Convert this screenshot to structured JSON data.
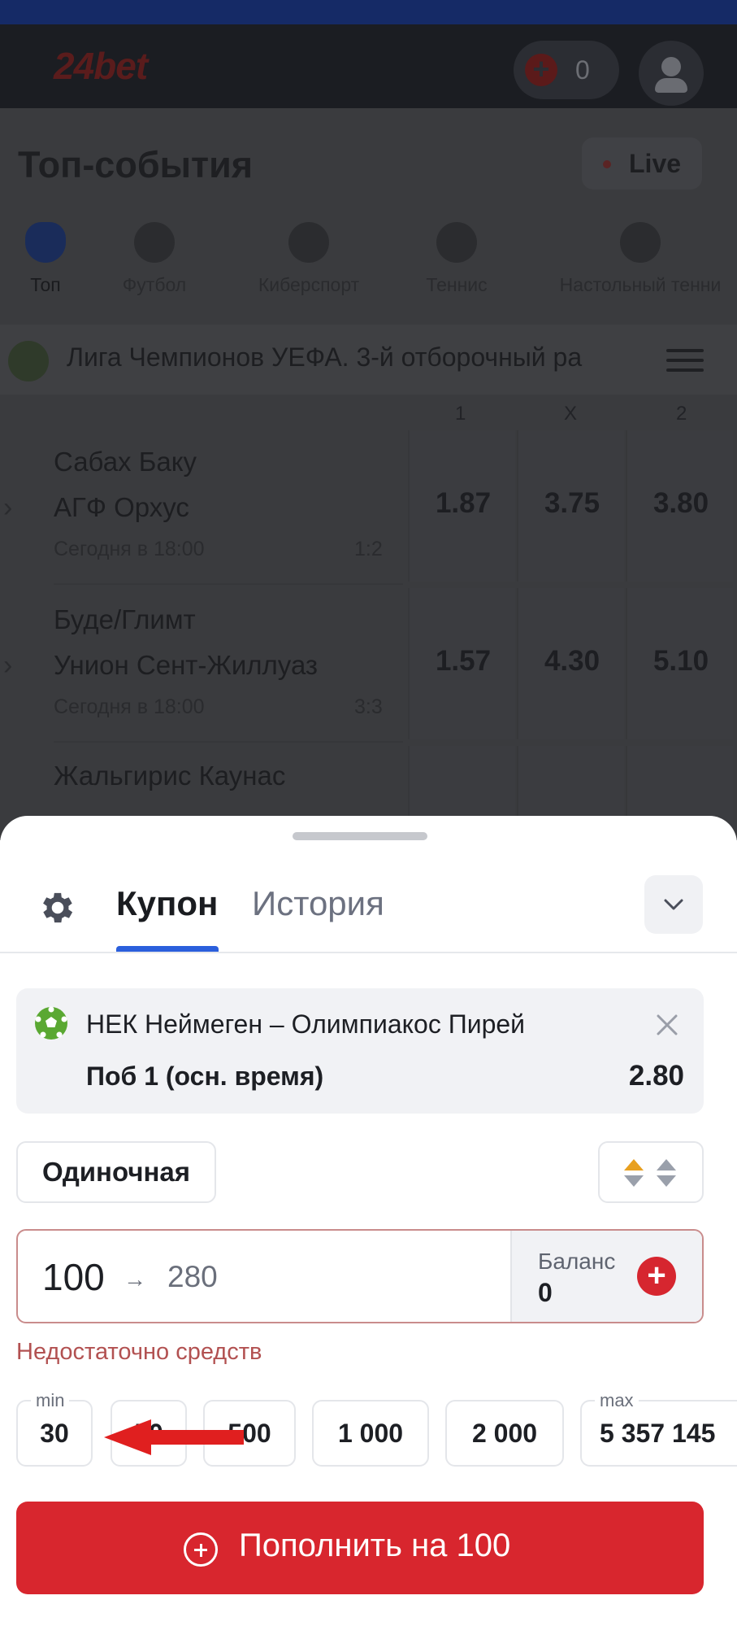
{
  "app": {
    "logo": "24bet",
    "wallet_count": "0"
  },
  "main": {
    "title": "Топ-события",
    "live_label": "Live",
    "sports": [
      {
        "label": "Топ"
      },
      {
        "label": "Футбол"
      },
      {
        "label": "Киберспорт"
      },
      {
        "label": "Теннис"
      },
      {
        "label": "Настольный тенни"
      }
    ],
    "league": "Лига Чемпионов УЕФА. 3-й отборочный ра",
    "odds_columns": [
      "1",
      "X",
      "2"
    ],
    "events": [
      {
        "home": "Сабах Баку",
        "away": "АГФ Орхус",
        "time": "Сегодня в 18:00",
        "score": "1:2",
        "odds": [
          "1.87",
          "3.75",
          "3.80"
        ]
      },
      {
        "home": "Буде/Глимт",
        "away": "Унион Сент-Жиллуаз",
        "time": "Сегодня в 18:00",
        "score": "3:3",
        "odds": [
          "1.57",
          "4.30",
          "5.10"
        ]
      },
      {
        "home": "Жальгирис Каунас",
        "away": "",
        "time": "",
        "score": "",
        "odds": [
          "",
          "",
          ""
        ]
      }
    ]
  },
  "coupon": {
    "tab_coupon": "Купон",
    "tab_history": "История",
    "bet": {
      "match": "НЕК Неймеген – Олимпиакос Пирей",
      "market": "Поб 1 (осн. время)",
      "odd": "2.80"
    },
    "bet_type": "Одиночная",
    "stake": "100",
    "arrow": "→",
    "potential_win": "280",
    "balance_label": "Баланс",
    "balance_value": "0",
    "error": "Недостаточно средств",
    "quick_amounts": {
      "min_tag": "min",
      "max_tag": "max",
      "values": [
        "30",
        "50",
        "500",
        "1 000",
        "2 000",
        "5 357 145"
      ]
    },
    "topup_label": "Пополнить на 100"
  },
  "colors": {
    "accent_red": "#d8262e",
    "tab_active": "#2b5fdc",
    "error_text": "#b25151"
  }
}
